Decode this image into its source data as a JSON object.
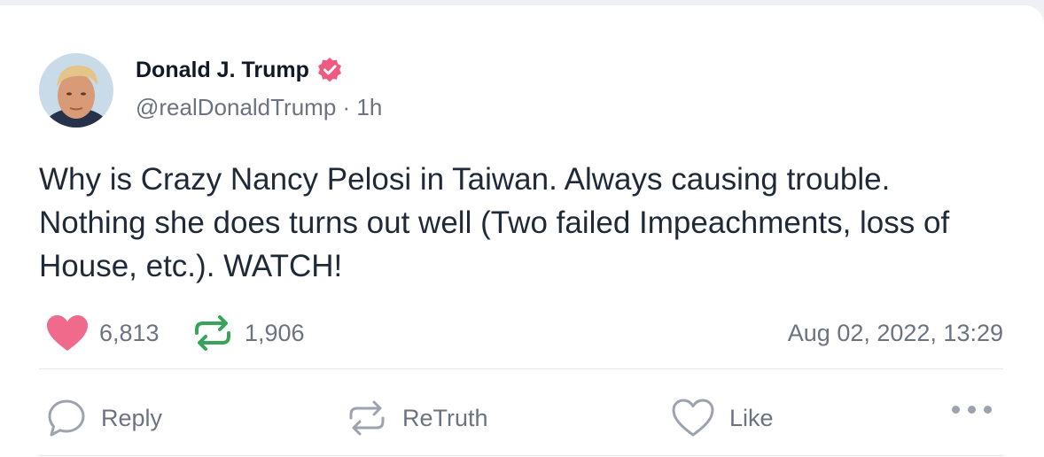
{
  "post": {
    "author_name": "Donald J. Trump",
    "handle": "@realDonaldTrump",
    "separator": "·",
    "relative_time": "1h",
    "text": "Why is Crazy Nancy Pelosi in Taiwan. Always causing trouble. Nothing she does turns out well (Two failed Impeachments, loss of House, etc.). WATCH!",
    "likes": "6,813",
    "retruths": "1,906",
    "timestamp": "Aug 02, 2022, 13:29"
  },
  "actions": {
    "reply_label": "Reply",
    "retruth_label": "ReTruth",
    "like_label": "Like"
  },
  "icons": {
    "verified": "verified-badge-icon",
    "likes": "heart-filled-icon",
    "retruths": "retruth-icon",
    "reply": "chat-bubble-icon",
    "retruth_action": "retruth-icon",
    "like_action": "heart-outline-icon",
    "more": "more-dots-icon"
  },
  "colors": {
    "verified": "#ef5b80",
    "like_heart": "#f06a8c",
    "retruth_green": "#3aa35a",
    "muted_text": "#6b7280",
    "main_text": "#1f2937"
  }
}
